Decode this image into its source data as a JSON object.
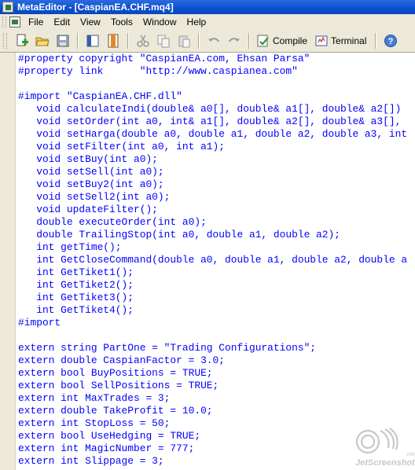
{
  "window": {
    "title": "MetaEditor - [CaspianEA.CHF.mq4]"
  },
  "menu": {
    "items": [
      "File",
      "Edit",
      "View",
      "Tools",
      "Window",
      "Help"
    ]
  },
  "toolbar": {
    "icons": [
      "new-file-icon",
      "open-folder-icon",
      "save-icon",
      "navigator-icon",
      "toolbox-icon",
      "cut-icon",
      "copy-icon",
      "paste-icon",
      "undo-icon",
      "redo-icon"
    ],
    "compile_label": "Compile",
    "terminal_label": "Terminal",
    "help_icon": "help-icon"
  },
  "code": {
    "lines": [
      "#property copyright \"CaspianEA.com, Ehsan Parsa\"",
      "#property link      \"http://www.caspianea.com\"",
      "",
      "#import \"CaspianEA.CHF.dll\"",
      "   void calculateIndi(double& a0[], double& a1[], double& a2[])",
      "   void setOrder(int a0, int& a1[], double& a2[], double& a3[],",
      "   void setHarga(double a0, double a1, double a2, double a3, int",
      "   void setFilter(int a0, int a1);",
      "   void setBuy(int a0);",
      "   void setSell(int a0);",
      "   void setBuy2(int a0);",
      "   void setSell2(int a0);",
      "   void updateFilter();",
      "   double executeOrder(int a0);",
      "   double TrailingStop(int a0, double a1, double a2);",
      "   int getTime();",
      "   int GetCloseCommand(double a0, double a1, double a2, double a",
      "   int GetTiket1();",
      "   int GetTiket2();",
      "   int GetTiket3();",
      "   int GetTiket4();",
      "#import",
      "",
      "extern string PartOne = \"Trading Configurations\";",
      "extern double CaspianFactor = 3.0;",
      "extern bool BuyPositions = TRUE;",
      "extern bool SellPositions = TRUE;",
      "extern int MaxTrades = 3;",
      "extern double TakeProfit = 10.0;",
      "extern int StopLoss = 50;",
      "extern bool UseHedging = TRUE;",
      "extern int MagicNumber = 777;",
      "extern int Slippage = 3;"
    ]
  },
  "watermark": {
    "text": "JetScreenshot",
    "text_tail": ".net"
  }
}
